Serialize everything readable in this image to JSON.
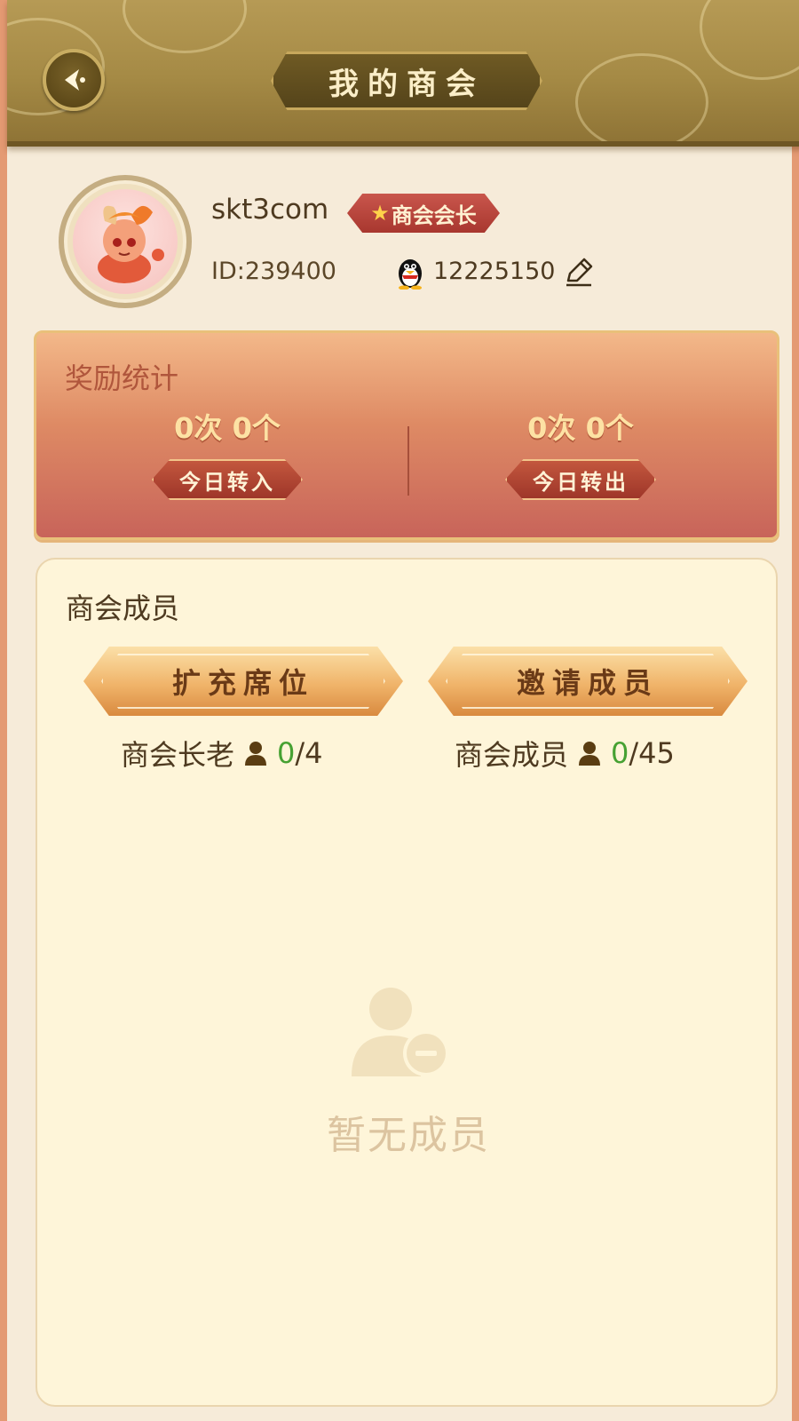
{
  "header": {
    "title": "我的商会"
  },
  "profile": {
    "username": "skt3com",
    "role": "商会会长",
    "id": "ID:239400",
    "qq": "12225150"
  },
  "rewards": {
    "title": "奖励统计",
    "in": {
      "value": "0次 0个",
      "label": "今日转入"
    },
    "out": {
      "value": "0次 0个",
      "label": "今日转出"
    }
  },
  "members": {
    "title": "商会成员",
    "expand_label": "扩充席位",
    "invite_label": "邀请成员",
    "elders": {
      "label": "商会长老",
      "current": "0",
      "max": "/4"
    },
    "members": {
      "label": "商会成员",
      "current": "0",
      "max": "/45"
    },
    "empty_text": "暂无成员"
  },
  "icons": [
    "back-arrow-icon",
    "star-icon",
    "qq-penguin-icon",
    "edit-pencil-icon",
    "person-icon",
    "empty-member-icon"
  ],
  "colors": {
    "accent_green": "#46a132",
    "header_gold": "#a58a45",
    "badge_red": "#b0413a"
  }
}
